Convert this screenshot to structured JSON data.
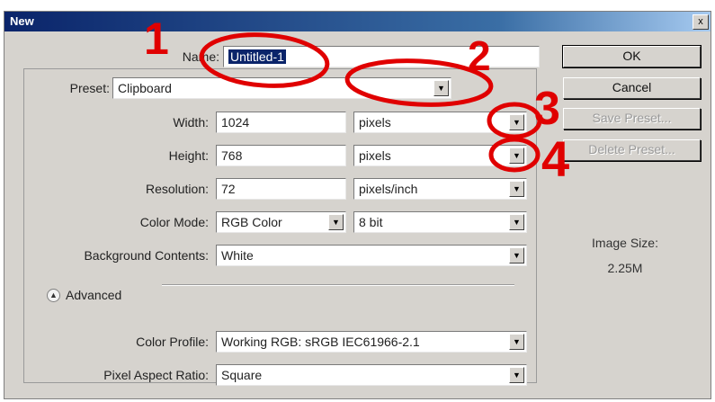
{
  "dialog": {
    "title": "New",
    "close_glyph": "x"
  },
  "form": {
    "name": {
      "label": "Name:",
      "value": "Untitled-1"
    },
    "preset": {
      "label": "Preset:",
      "value": "Clipboard"
    },
    "width": {
      "label": "Width:",
      "value": "1024",
      "unit": "pixels"
    },
    "height": {
      "label": "Height:",
      "value": "768",
      "unit": "pixels"
    },
    "resolution": {
      "label": "Resolution:",
      "value": "72",
      "unit": "pixels/inch"
    },
    "color_mode": {
      "label": "Color Mode:",
      "value": "RGB Color",
      "depth": "8 bit"
    },
    "background": {
      "label": "Background Contents:",
      "value": "White"
    },
    "advanced": {
      "label": "Advanced",
      "icon": "collapse-up-icon"
    },
    "color_profile": {
      "label": "Color Profile:",
      "value": "Working RGB:  sRGB IEC61966-2.1"
    },
    "pixel_aspect": {
      "label": "Pixel Aspect Ratio:",
      "value": "Square"
    }
  },
  "buttons": {
    "ok": "OK",
    "cancel": "Cancel",
    "save_preset": "Save Preset...",
    "delete_preset": "Delete Preset..."
  },
  "image_size": {
    "label": "Image Size:",
    "value": "2.25M"
  },
  "annotations": {
    "color": "#e00000",
    "numbers": [
      "1",
      "2",
      "3",
      "4"
    ]
  }
}
